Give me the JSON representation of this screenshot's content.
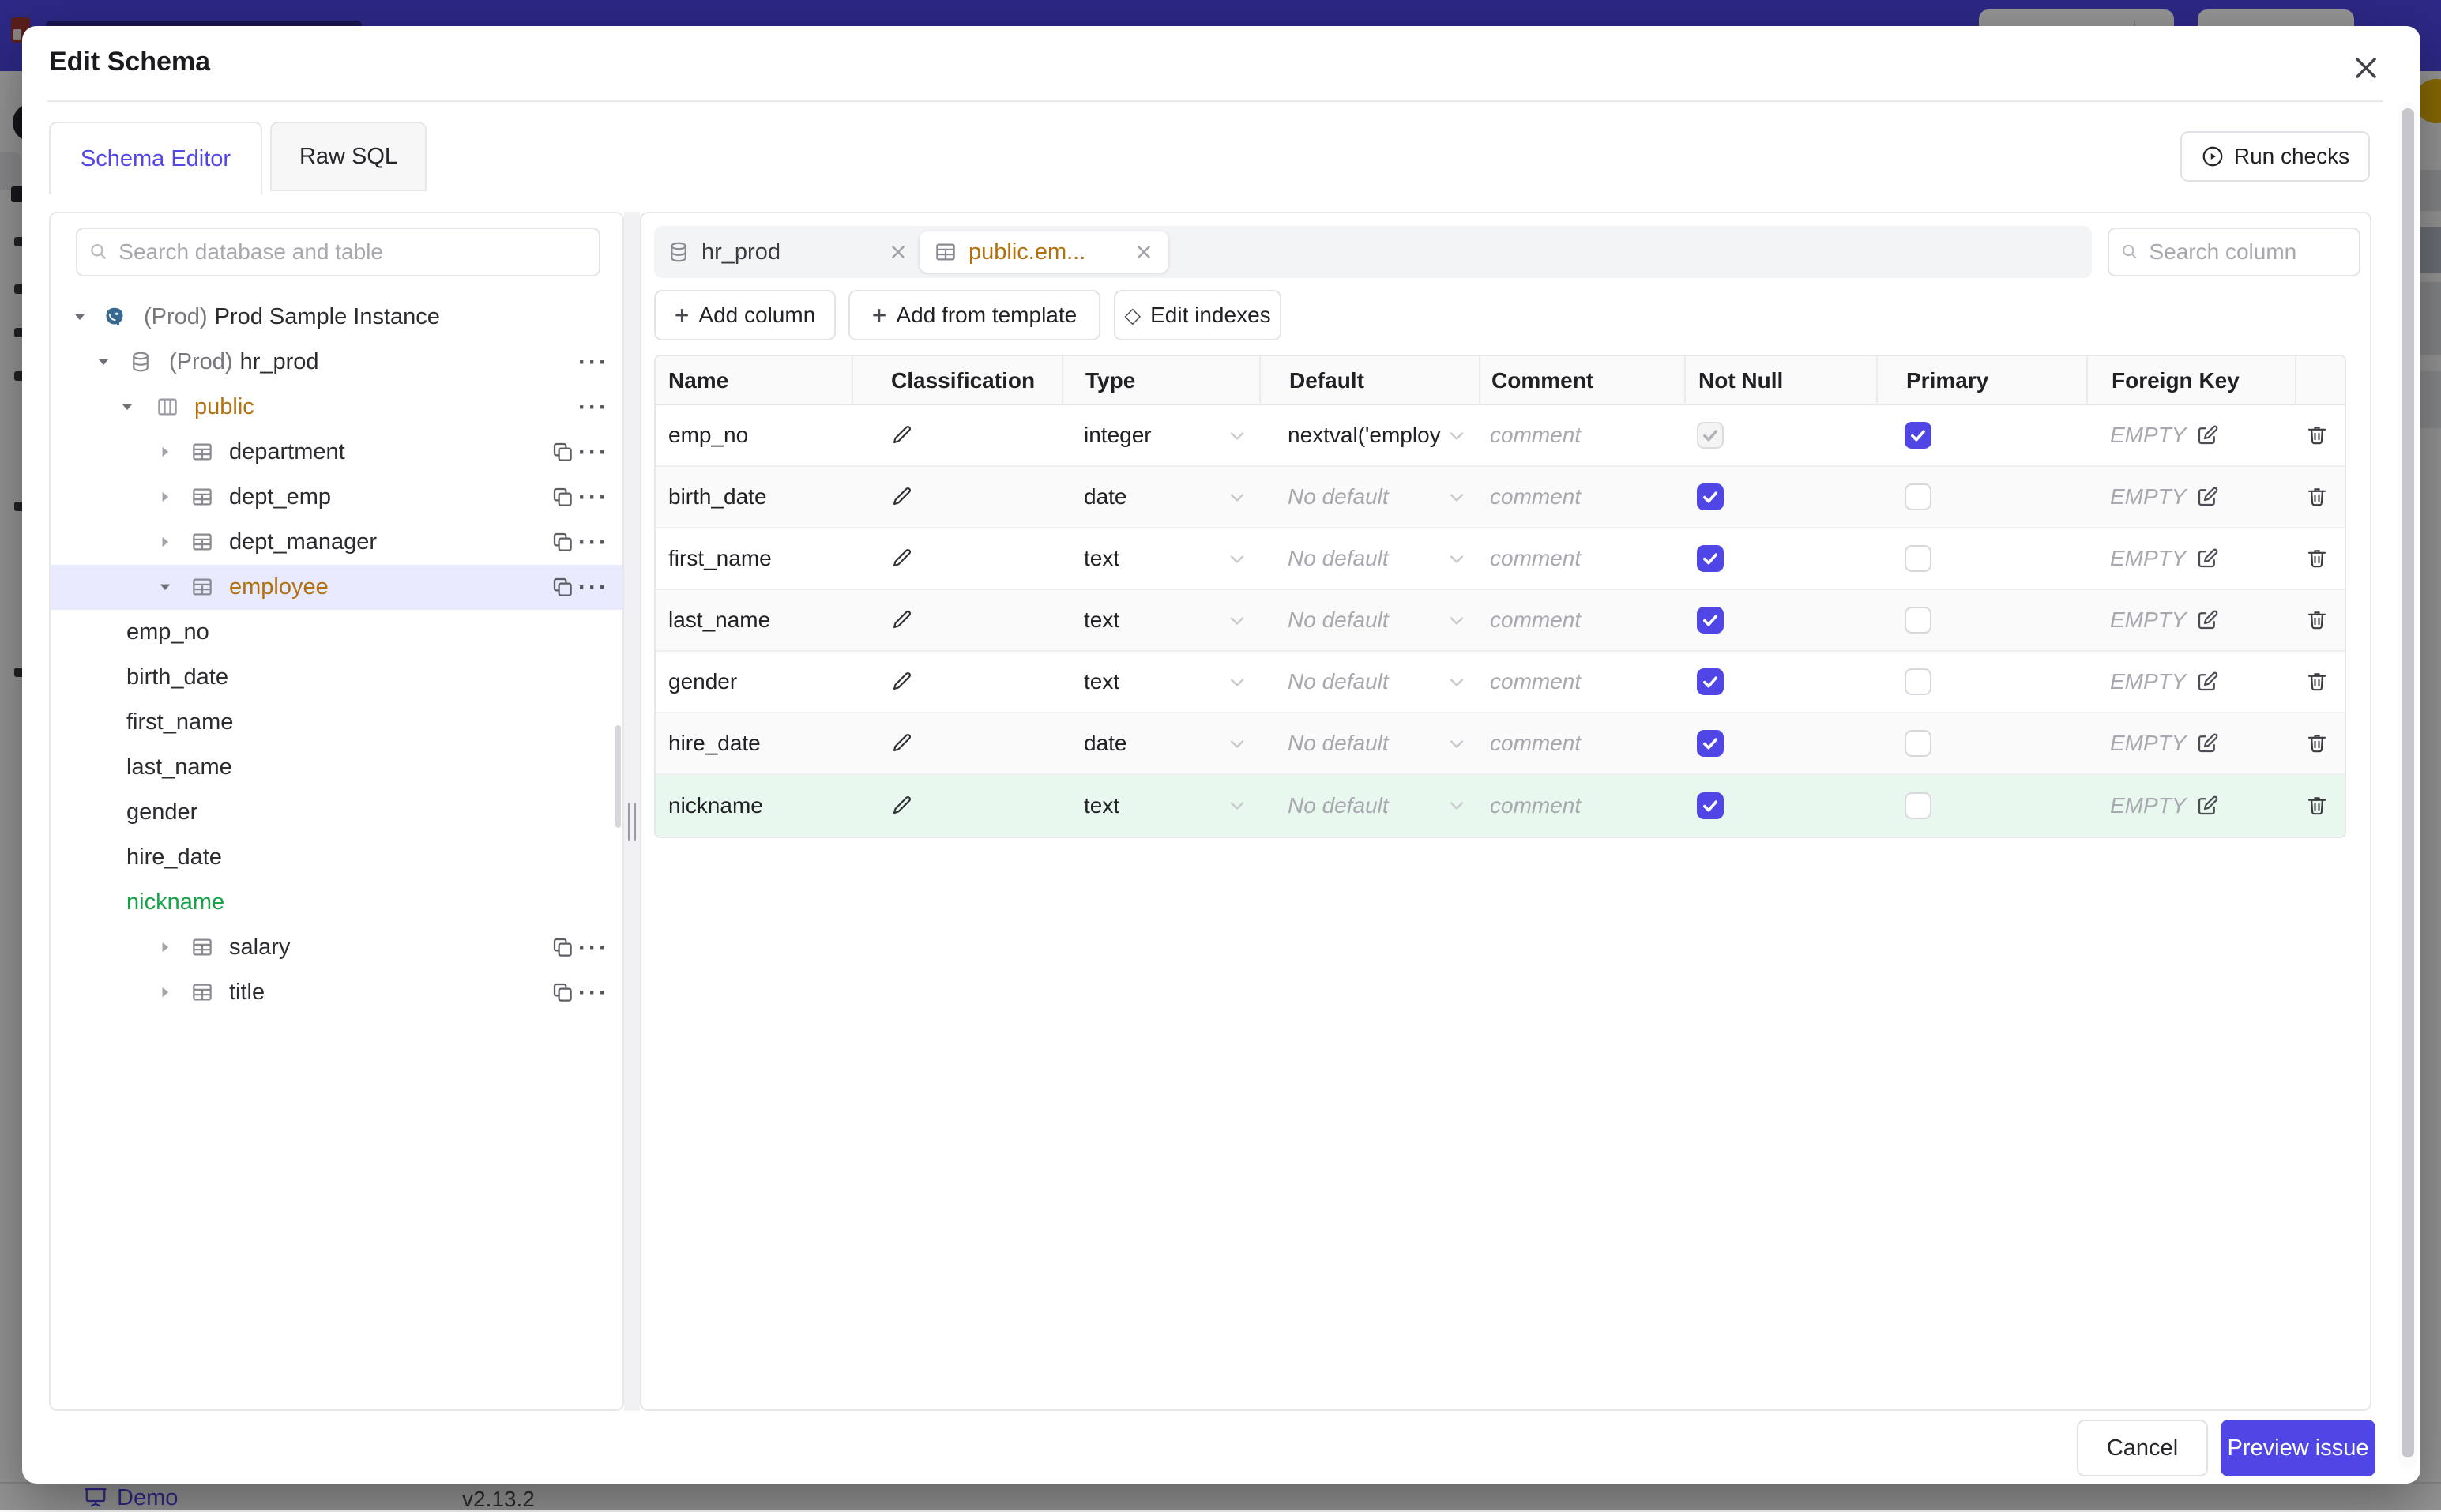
{
  "colors": {
    "accent": "#4f46e5",
    "table_name_text": "#b2700e",
    "added_text": "#16a34a",
    "added_row_bg": "#e9f8ef",
    "selected_tree_row_bg": "#e8eafd",
    "header_bar": "#4f46e5"
  },
  "background": {
    "demo_label": "Demo",
    "version": "v2.13.2"
  },
  "modal": {
    "title": "Edit Schema",
    "tabs": [
      {
        "label": "Schema Editor",
        "active": true
      },
      {
        "label": "Raw SQL",
        "active": false
      }
    ],
    "run_checks_label": "Run checks"
  },
  "sidebar": {
    "search_placeholder": "Search database and table",
    "tree": [
      {
        "level": "1",
        "caret": "down",
        "icon": "postgres-icon",
        "prefix": "(Prod)",
        "label": "Prod Sample Instance",
        "actions": []
      },
      {
        "level": "2",
        "caret": "down",
        "icon": "database-icon",
        "prefix": "(Prod)",
        "label": "hr_prod",
        "actions": [
          "menu"
        ]
      },
      {
        "level": "3",
        "caret": "down",
        "icon": "schema-icon",
        "label": "public",
        "highlight": "amber",
        "actions": [
          "menu"
        ]
      },
      {
        "level": "4",
        "caret": "right",
        "icon": "table-icon",
        "label": "department",
        "actions": [
          "copy",
          "menu"
        ]
      },
      {
        "level": "4",
        "caret": "right",
        "icon": "table-icon",
        "label": "dept_emp",
        "actions": [
          "copy",
          "menu"
        ]
      },
      {
        "level": "4",
        "caret": "right",
        "icon": "table-icon",
        "label": "dept_manager",
        "actions": [
          "copy",
          "menu"
        ]
      },
      {
        "level": "4",
        "caret": "down",
        "icon": "table-icon",
        "label": "employee",
        "highlight": "amber",
        "selected": true,
        "actions": [
          "copy",
          "menu"
        ]
      },
      {
        "level": "column",
        "label": "emp_no"
      },
      {
        "level": "column",
        "label": "birth_date"
      },
      {
        "level": "column",
        "label": "first_name"
      },
      {
        "level": "column",
        "label": "last_name"
      },
      {
        "level": "column",
        "label": "gender"
      },
      {
        "level": "column",
        "label": "hire_date"
      },
      {
        "level": "column",
        "label": "nickname",
        "highlight": "green"
      },
      {
        "level": "4",
        "caret": "right",
        "icon": "table-icon",
        "label": "salary",
        "actions": [
          "copy",
          "menu"
        ]
      },
      {
        "level": "4",
        "caret": "right",
        "icon": "table-icon",
        "label": "title",
        "actions": [
          "copy",
          "menu"
        ]
      }
    ]
  },
  "editor": {
    "chips": [
      {
        "icon": "database-icon",
        "label": "hr_prod",
        "active": false
      },
      {
        "icon": "table-icon",
        "label": "public.em...",
        "active": true
      }
    ],
    "search_placeholder": "Search column",
    "toolbar": [
      {
        "icon": "plus",
        "label": "Add column"
      },
      {
        "icon": "plus",
        "label": "Add from template"
      },
      {
        "icon": "diamond",
        "label": "Edit indexes"
      }
    ],
    "table": {
      "headers": [
        "Name",
        "Classification",
        "Type",
        "Default",
        "Comment",
        "Not Null",
        "Primary",
        "Foreign Key",
        ""
      ],
      "comment_placeholder": "comment",
      "foreign_key_empty": "EMPTY",
      "rows": [
        {
          "name": "emp_no",
          "type": "integer",
          "default": "nextval('employ",
          "has_default": true,
          "not_null": "checked-disabled",
          "primary": "checked",
          "variant": "default"
        },
        {
          "name": "birth_date",
          "type": "date",
          "default": "No default",
          "has_default": false,
          "not_null": "checked",
          "primary": "unchecked",
          "variant": "alt"
        },
        {
          "name": "first_name",
          "type": "text",
          "default": "No default",
          "has_default": false,
          "not_null": "checked",
          "primary": "unchecked",
          "variant": "default"
        },
        {
          "name": "last_name",
          "type": "text",
          "default": "No default",
          "has_default": false,
          "not_null": "checked",
          "primary": "unchecked",
          "variant": "alt"
        },
        {
          "name": "gender",
          "type": "text",
          "default": "No default",
          "has_default": false,
          "not_null": "checked",
          "primary": "unchecked",
          "variant": "default"
        },
        {
          "name": "hire_date",
          "type": "date",
          "default": "No default",
          "has_default": false,
          "not_null": "checked",
          "primary": "unchecked",
          "variant": "alt"
        },
        {
          "name": "nickname",
          "type": "text",
          "default": "No default",
          "has_default": false,
          "not_null": "checked",
          "primary": "unchecked",
          "variant": "added"
        }
      ]
    }
  },
  "footer": {
    "cancel_label": "Cancel",
    "preview_label": "Preview issue"
  }
}
